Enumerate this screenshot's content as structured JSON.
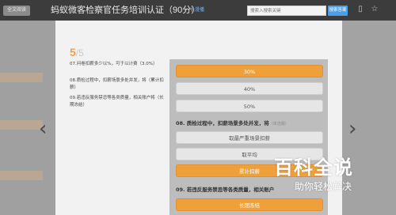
{
  "toolbar": {
    "fulltext_label": "全文阅读",
    "title": "蚂蚁微客检察官任务培训认证（90分）",
    "listen_label": "长漫播",
    "search_placeholder": "搜索入搜索关键",
    "search_button": "搜索答案"
  },
  "progress": {
    "current": "5",
    "total": "/5"
  },
  "question_list": [
    "07.问卷扣薪多少以%，可于以计费（3.0%）",
    "08.质检过程中，扣薪场景多处并发，将（累计扣薪）",
    "09.若违反服务禁忌等各类质量，相关账户将（长期冻结）"
  ],
  "options_q7": [
    {
      "label": "30%",
      "selected": true
    },
    {
      "label": "40%",
      "selected": false
    },
    {
      "label": "50%",
      "selected": false
    }
  ],
  "q8": {
    "text": "08. 质检过程中，扣薪场景多处并发，将",
    "hint": "（单选题）",
    "options": [
      {
        "label": "取最严重场景扣薪",
        "selected": false
      },
      {
        "label": "取平均",
        "selected": false
      },
      {
        "label": "累计扣薪",
        "selected": true
      }
    ]
  },
  "q9": {
    "text": "09. 若违反服务禁忌等各类质量，相关账户",
    "options": [
      {
        "label": "长期冻结",
        "selected": true
      }
    ]
  },
  "watermark": {
    "title": "百科全说",
    "subtitle": "助你轻松解决"
  },
  "colors": {
    "accent_orange": "#f0a03a",
    "topbar": "#3c3c3c",
    "search_button": "#4a9ee8"
  }
}
